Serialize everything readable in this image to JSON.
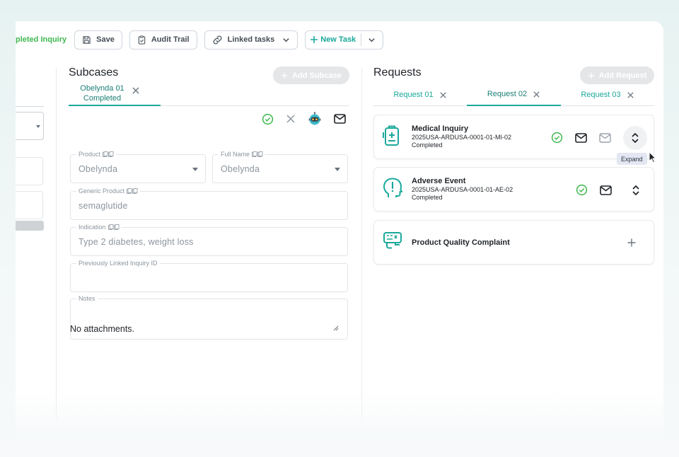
{
  "toolbar": {
    "status_text": "pleted Inquiry",
    "save_label": "Save",
    "audit_label": "Audit Trail",
    "linked_label": "Linked tasks",
    "newtask_label": "New Task"
  },
  "subcases": {
    "title": "Subcases",
    "add_label": "Add Subcase",
    "tab": {
      "name": "Obelynda 01",
      "status": "Completed"
    },
    "fields": {
      "product": {
        "label": "Product",
        "value": "Obelynda"
      },
      "full_name": {
        "label": "Full Name",
        "value": "Obelynda"
      },
      "generic": {
        "label": "Generic Product",
        "value": "semaglutide"
      },
      "indication": {
        "label": "Indication",
        "value": "Type 2 diabetes, weight loss"
      },
      "prev_inquiry": {
        "label": "Previously Linked Inquiry ID",
        "value": ""
      },
      "notes": {
        "label": "Notes",
        "value": ""
      }
    },
    "attachments_text": "No attachments."
  },
  "requests": {
    "title": "Requests",
    "add_label": "Add Request",
    "tabs": [
      {
        "label": "Request 01"
      },
      {
        "label": "Request 02"
      },
      {
        "label": "Request 03"
      }
    ],
    "active_tab": 1,
    "cards": [
      {
        "name": "Medical Inquiry",
        "id": "2025USA-ARDUSA-0001-01-MI-02",
        "status": "Completed",
        "icon": "medical-iv-bag-icon"
      },
      {
        "name": "Adverse Event",
        "id": "2025USA-ARDUSA-0001-01-AE-02",
        "status": "Completed",
        "icon": "head-exclamation-icon"
      },
      {
        "name": "Product Quality Complaint",
        "icon": "pqc-device-icon"
      }
    ],
    "tooltip": "Expand"
  },
  "colors": {
    "accent": "#1aa89b",
    "success": "#3fb950",
    "muted": "#8c959f"
  }
}
